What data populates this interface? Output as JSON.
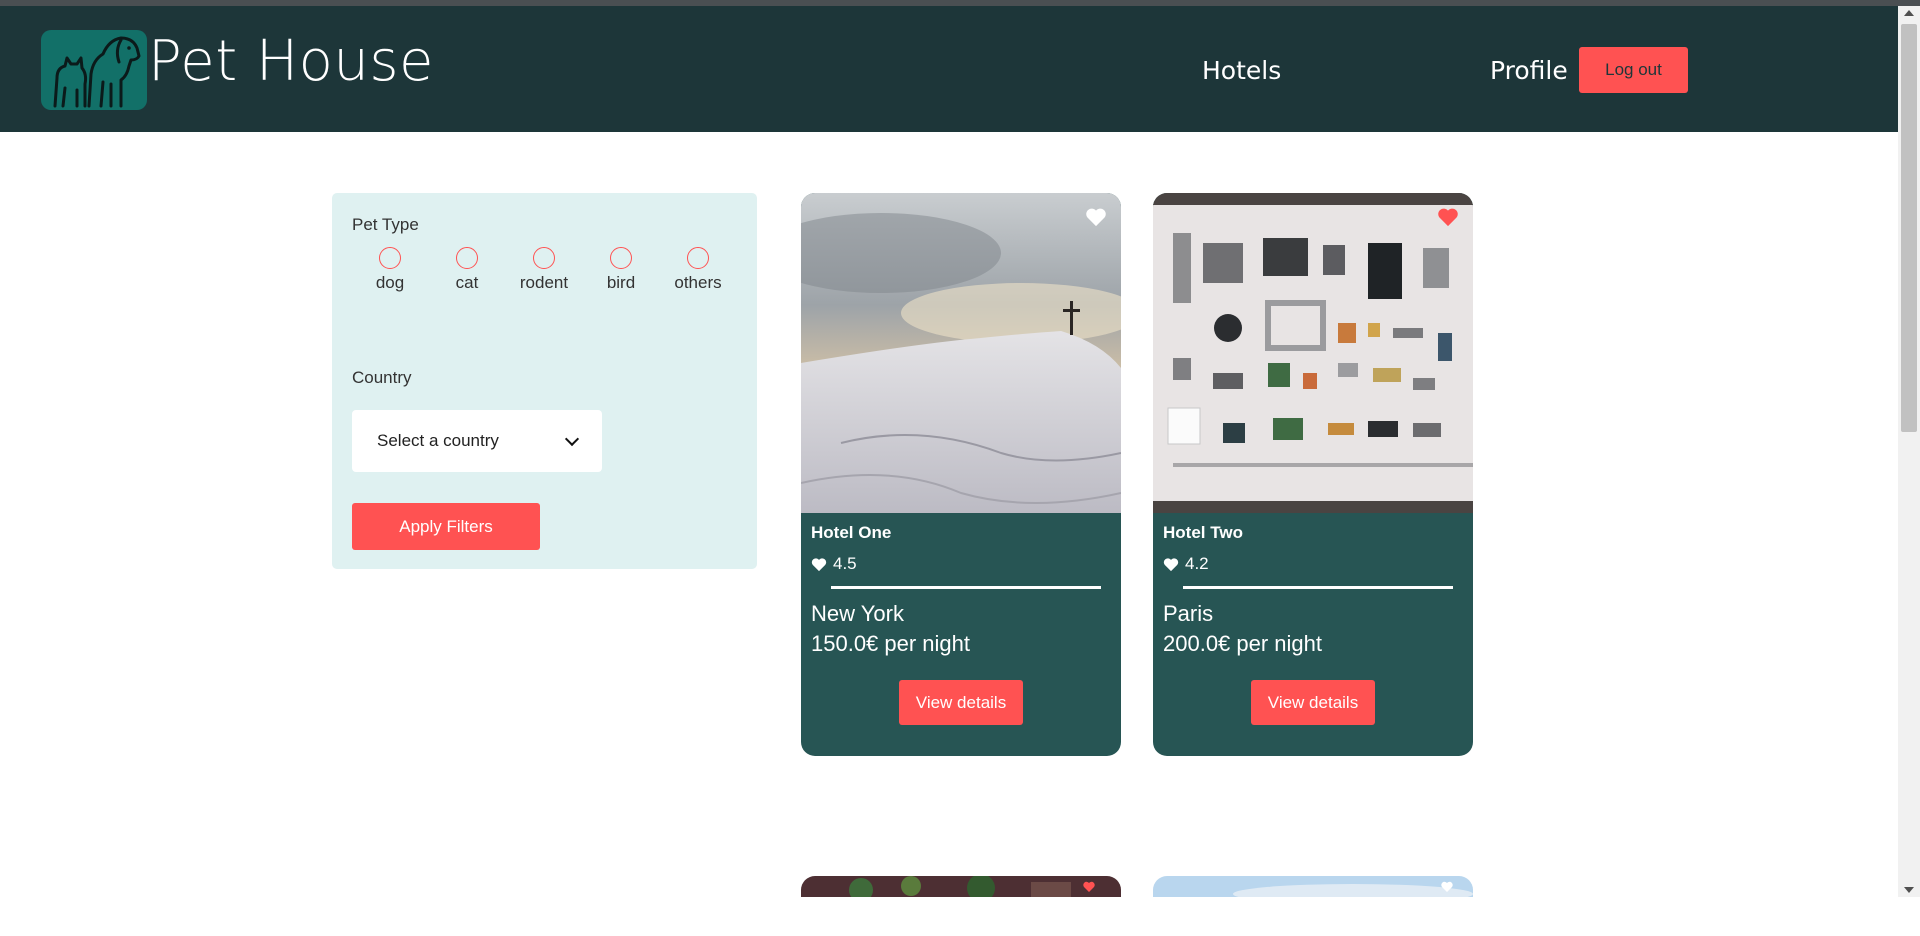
{
  "app": {
    "brand": "Pet House"
  },
  "nav": {
    "hotels": "Hotels",
    "profile": "Profile",
    "logout": "Log out"
  },
  "filters": {
    "pet_type_label": "Pet Type",
    "pet_types": [
      "dog",
      "cat",
      "rodent",
      "bird",
      "others"
    ],
    "country_label": "Country",
    "country_selected": "Select a country",
    "apply": "Apply Filters"
  },
  "hotels": [
    {
      "name": "Hotel One",
      "rating": "4.5",
      "city": "New York",
      "price": "150.0€ per night",
      "action": "View details",
      "favorite": false
    },
    {
      "name": "Hotel Two",
      "rating": "4.2",
      "city": "Paris",
      "price": "200.0€ per night",
      "action": "View details",
      "favorite": true
    }
  ],
  "colors": {
    "navbar": "#1d3639",
    "accent": "#ff5252",
    "card": "#275554",
    "filter_panel": "#dff1f1",
    "logo_bg": "#127068"
  }
}
